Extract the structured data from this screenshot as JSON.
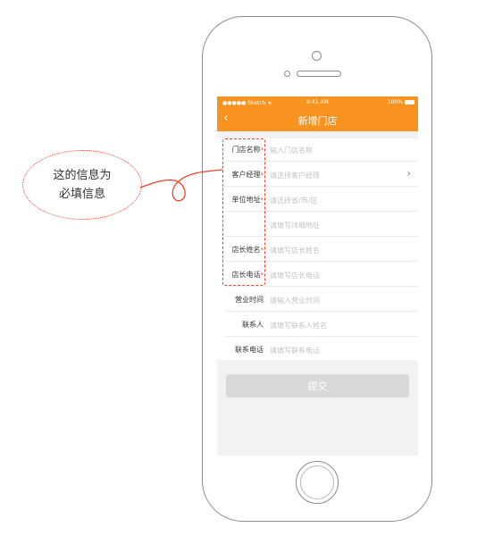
{
  "status_bar": {
    "carrier": "●●●●● Sketch ᯤ",
    "time": "9:41 AM",
    "battery": "100%"
  },
  "nav": {
    "back_icon": "‹",
    "title": "新增门店"
  },
  "form": {
    "rows": [
      {
        "label": "门店名称",
        "required_mark": "*",
        "placeholder": "输入门店名称"
      },
      {
        "label": "客户经理",
        "required_mark": "*",
        "placeholder": "请选择客户经理",
        "chevron": "›"
      },
      {
        "label": "单位地址",
        "required_mark": "*",
        "placeholder": "请选择省/市/区"
      },
      {
        "label": "",
        "required_mark": "",
        "placeholder": "请填写详细地址"
      },
      {
        "label": "店长姓名",
        "required_mark": "*",
        "placeholder": "请填写店长姓名"
      },
      {
        "label": "店长电话",
        "required_mark": "*",
        "placeholder": "请填写店长电话"
      },
      {
        "label": "营业时间",
        "required_mark": "",
        "placeholder": "请输入营业时间"
      },
      {
        "label": "联系人",
        "required_mark": "",
        "placeholder": "请填写联系人姓名"
      },
      {
        "label": "联系电话",
        "required_mark": "",
        "placeholder": "请填写联系电话"
      }
    ]
  },
  "submit_label": "提交",
  "annotation": {
    "line1": "这的信息为",
    "line2": "必填信息"
  },
  "colors": {
    "accent": "#f7931e",
    "required": "#e8452c",
    "annotation": "#e8452c",
    "submit_disabled": "#d9d9d9"
  }
}
